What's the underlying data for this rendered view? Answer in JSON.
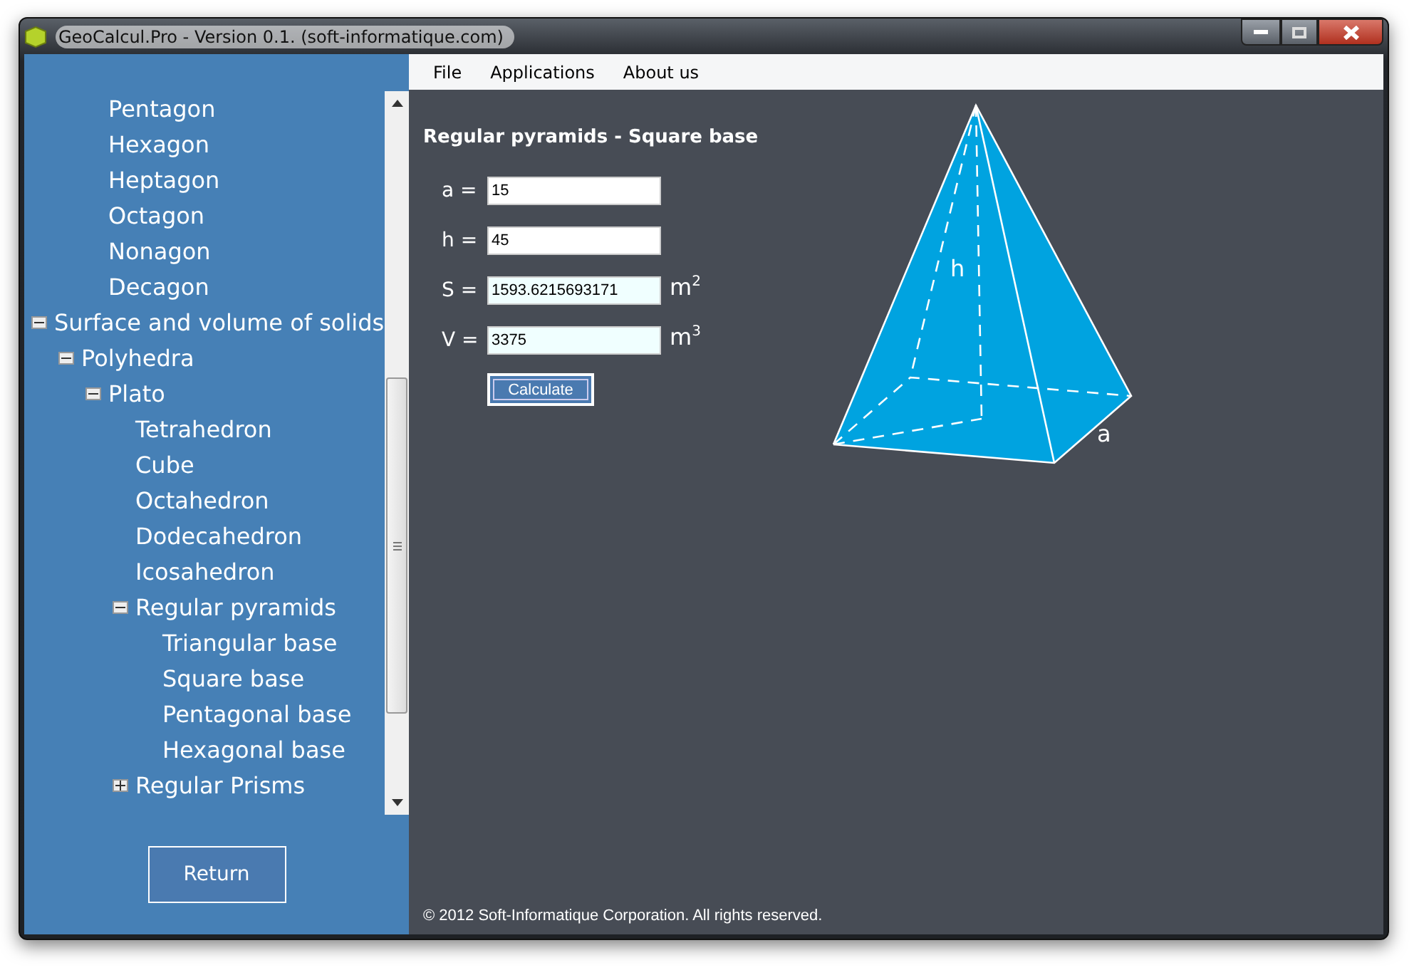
{
  "window": {
    "title": "GeoCalcul.Pro - Version 0.1. (soft-informatique.com)"
  },
  "menu": [
    "File",
    "Applications",
    "About us"
  ],
  "tree": [
    {
      "children": [
        {
          "children": [
            {
              "label": "Pentagon"
            },
            {
              "label": "Hexagon"
            },
            {
              "label": "Heptagon"
            },
            {
              "label": "Octagon"
            },
            {
              "label": "Nonagon"
            },
            {
              "label": "Decagon"
            }
          ]
        }
      ]
    },
    {
      "label": "Surface and volume of solids",
      "expanded": true,
      "children": [
        {
          "label": "Polyhedra",
          "expanded": true,
          "children": [
            {
              "label": "Plato",
              "expanded": true,
              "children": [
                {
                  "label": "Tetrahedron"
                },
                {
                  "label": "Cube"
                },
                {
                  "label": "Octahedron"
                },
                {
                  "label": "Dodecahedron"
                },
                {
                  "label": "Icosahedron"
                },
                {
                  "label": "Regular pyramids",
                  "expanded": true,
                  "children": [
                    {
                      "label": "Triangular base"
                    },
                    {
                      "label": "Square base"
                    },
                    {
                      "label": "Pentagonal base"
                    },
                    {
                      "label": "Hexagonal base"
                    }
                  ]
                },
                {
                  "label": "Regular Prisms",
                  "expanded": false
                }
              ]
            }
          ]
        }
      ]
    }
  ],
  "return_button": "Return",
  "form": {
    "title": "Regular pyramids - Square base",
    "fields": [
      {
        "label": "a =",
        "value": "15",
        "readonly": false
      },
      {
        "label": "h =",
        "value": "45",
        "readonly": false
      },
      {
        "label": "S =",
        "value": "1593.6215693171",
        "readonly": true,
        "unit": "m$^{2}$"
      },
      {
        "label": "V =",
        "value": "3375",
        "readonly": true,
        "unit": "m$^{3}$"
      }
    ],
    "button": "Calculate"
  },
  "diagram": {
    "labels": [
      "h",
      "a"
    ]
  },
  "footer": "© 2012 Soft-Informatique Corporation. All rights reserved."
}
